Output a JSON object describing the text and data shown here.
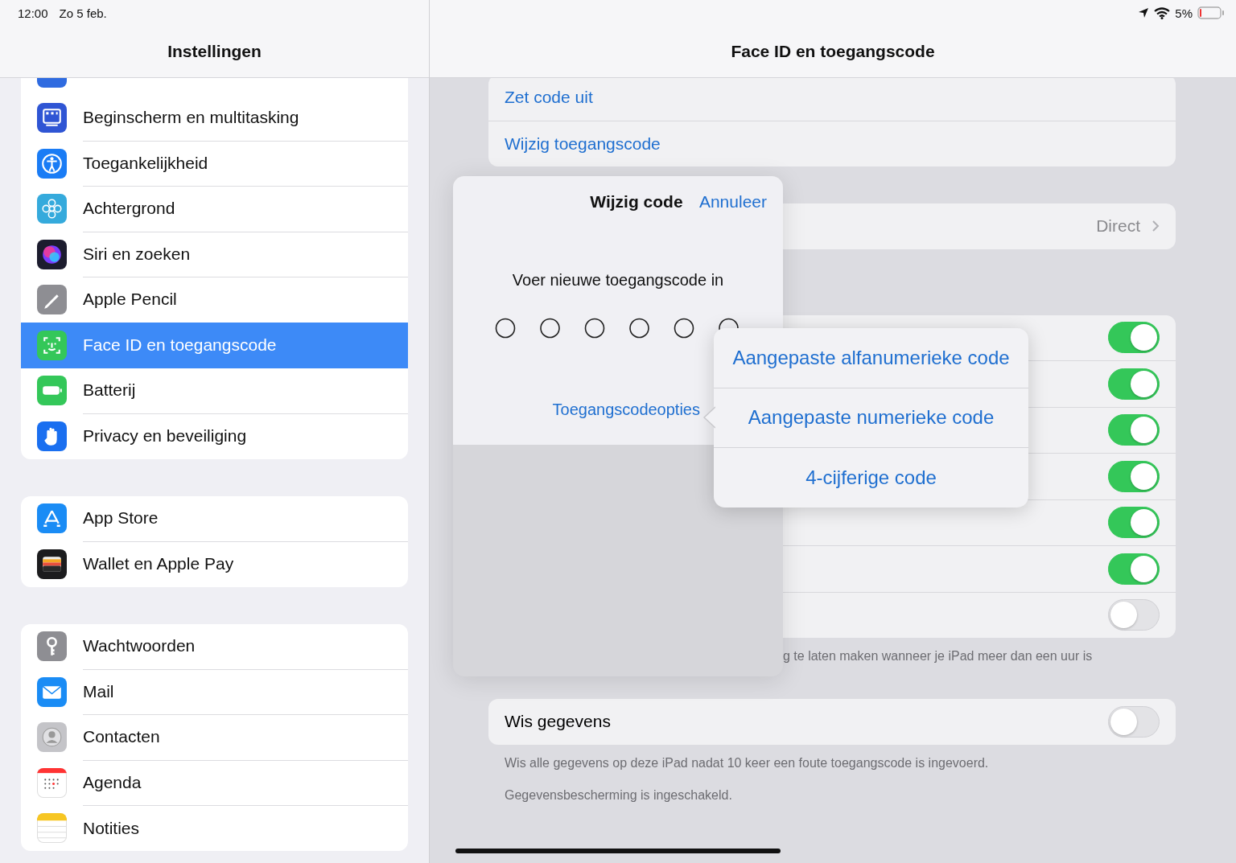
{
  "status_bar": {
    "time": "12:00",
    "date": "Zo 5 feb.",
    "battery": "5%"
  },
  "sidebar": {
    "title": "Instellingen",
    "groups": [
      {
        "items": [
          {
            "label": "Beginscherm en multitasking",
            "selected": false,
            "color": "#2f55d4"
          },
          {
            "label": "Toegankelijkheid",
            "selected": false,
            "color": "#1a7cf5"
          },
          {
            "label": "Achtergrond",
            "selected": false,
            "color": "#35aadc"
          },
          {
            "label": "Siri en zoeken",
            "selected": false,
            "color": "#1c1c2e"
          },
          {
            "label": "Apple Pencil",
            "selected": false,
            "color": "#8e8e93"
          },
          {
            "label": "Face ID en toegangscode",
            "selected": true,
            "color": "#34c759"
          },
          {
            "label": "Batterij",
            "selected": false,
            "color": "#34c759"
          },
          {
            "label": "Privacy en beveiliging",
            "selected": false,
            "color": "#1a6ff0"
          }
        ]
      },
      {
        "items": [
          {
            "label": "App Store",
            "selected": false,
            "color": "#1a8cf5"
          },
          {
            "label": "Wallet en Apple Pay",
            "selected": false,
            "color": "#1c1c1e"
          }
        ]
      },
      {
        "items": [
          {
            "label": "Wachtwoorden",
            "selected": false,
            "color": "#8e8e93"
          },
          {
            "label": "Mail",
            "selected": false,
            "color": "#1a8cf5"
          },
          {
            "label": "Contacten",
            "selected": false,
            "color": "#c4c4c8"
          },
          {
            "label": "Agenda",
            "selected": false,
            "color": "#ffffff"
          },
          {
            "label": "Notities",
            "selected": false,
            "color": "#ffffff"
          }
        ]
      }
    ]
  },
  "detail": {
    "title": "Face ID en toegangscode",
    "code_actions": [
      "Zet code uit",
      "Wijzig toegangscode"
    ],
    "require_value": "Direct",
    "toggles": [
      {
        "on": true
      },
      {
        "on": true
      },
      {
        "on": true
      },
      {
        "on": true
      },
      {
        "on": true
      },
      {
        "on": true
      },
      {
        "on": false
      }
    ],
    "toggles_footer": "g te laten maken wanneer je iPad meer dan een uur is",
    "erase": {
      "label": "Wis gegevens",
      "on": false
    },
    "notes": [
      "Wis alle gegevens op deze iPad nadat 10 keer een foute toegangscode is ingevoerd.",
      "Gegevensbescherming is ingeschakeld."
    ]
  },
  "dialog": {
    "title": "Wijzig code",
    "cancel": "Annuleer",
    "prompt": "Voer nieuwe toegangscode in",
    "options_link": "Toegangscodeopties"
  },
  "popover": {
    "options": [
      "Aangepaste alfanumerieke code",
      "Aangepaste numerieke code",
      "4-cijferige code"
    ]
  }
}
